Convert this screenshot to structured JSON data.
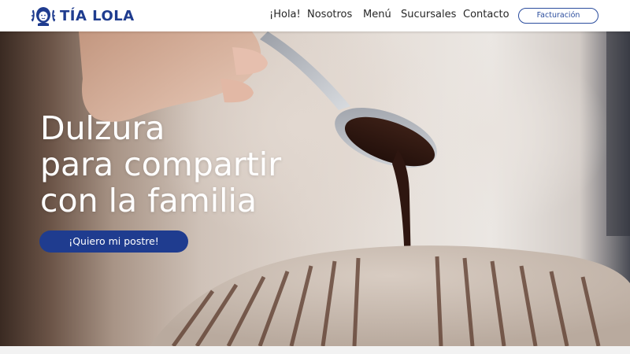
{
  "brand": {
    "name": "TÍA LOLA",
    "color": "#1f3c8f"
  },
  "nav": {
    "items": [
      {
        "label": "¡Hola!"
      },
      {
        "label": "Nosotros"
      },
      {
        "label": "Menú"
      },
      {
        "label": "Sucursales"
      },
      {
        "label": "Contacto"
      }
    ],
    "billing_button": "Facturación"
  },
  "hero": {
    "title_lines": [
      "Dulzura",
      "para compartir",
      "con la familia"
    ],
    "cta_label": "¡Quiero mi postre!",
    "image": "chocolate-spoon-drizzle-over-cake"
  }
}
